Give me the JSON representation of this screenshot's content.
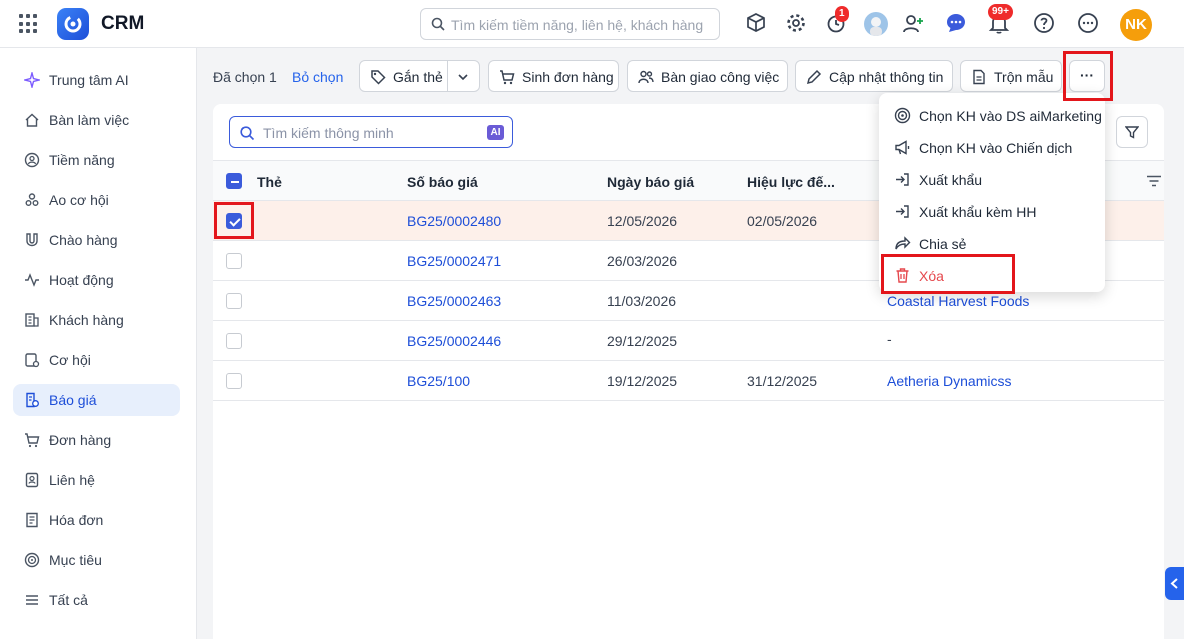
{
  "app": {
    "title": "CRM"
  },
  "topbar": {
    "search_placeholder": "Tìm kiếm tiềm năng, liên hệ, khách hàng",
    "timer_badge": "1",
    "notification_badge": "99+",
    "user_initials": "NK"
  },
  "sidebar": {
    "items": [
      {
        "label": "Trung tâm AI",
        "icon": "sparkle-icon"
      },
      {
        "label": "Bàn làm việc",
        "icon": "home-icon"
      },
      {
        "label": "Tiềm năng",
        "icon": "target-user-icon"
      },
      {
        "label": "Ao cơ hội",
        "icon": "users-icon"
      },
      {
        "label": "Chào hàng",
        "icon": "magnet-icon"
      },
      {
        "label": "Hoạt động",
        "icon": "activity-icon"
      },
      {
        "label": "Khách hàng",
        "icon": "building-icon"
      },
      {
        "label": "Cơ hội",
        "icon": "opportunity-icon"
      },
      {
        "label": "Báo giá",
        "icon": "quote-icon",
        "active": true
      },
      {
        "label": "Đơn hàng",
        "icon": "cart-icon"
      },
      {
        "label": "Liên hệ",
        "icon": "contact-icon"
      },
      {
        "label": "Hóa đơn",
        "icon": "invoice-icon"
      },
      {
        "label": "Mục tiêu",
        "icon": "goal-icon"
      },
      {
        "label": "Tất cả",
        "icon": "menu-icon"
      }
    ]
  },
  "toolbar": {
    "selected_text": "Đã chọn 1",
    "deselect": "Bỏ chọn",
    "tag": "Gắn thẻ",
    "create_order": "Sinh đơn hàng",
    "assign": "Bàn giao công việc",
    "update_info": "Cập nhật thông tin",
    "merge": "Trộn mẫu",
    "more": "···"
  },
  "search": {
    "placeholder": "Tìm kiếm thông minh",
    "ai_badge": "AI"
  },
  "table": {
    "columns": [
      "Thẻ",
      "Số báo giá",
      "Ngày báo giá",
      "Hiệu lực đế..."
    ],
    "rows": [
      {
        "checked": true,
        "number": "BG25/0002480",
        "date": "12/05/2026",
        "valid_until": "02/05/2026",
        "customer": ""
      },
      {
        "checked": false,
        "number": "BG25/0002471",
        "date": "26/03/2026",
        "valid_until": "",
        "customer": ""
      },
      {
        "checked": false,
        "number": "BG25/0002463",
        "date": "11/03/2026",
        "valid_until": "",
        "customer": "Coastal Harvest Foods"
      },
      {
        "checked": false,
        "number": "BG25/0002446",
        "date": "29/12/2025",
        "valid_until": "",
        "customer": "-"
      },
      {
        "checked": false,
        "number": "BG25/100",
        "date": "19/12/2025",
        "valid_until": "31/12/2025",
        "customer": "Aetheria Dynamicss"
      }
    ]
  },
  "menu": {
    "items": [
      {
        "label": "Chọn KH vào DS aiMarketing",
        "icon": "target-icon"
      },
      {
        "label": "Chọn KH vào Chiến dịch",
        "icon": "megaphone-icon"
      },
      {
        "label": "Xuất khẩu",
        "icon": "export-icon"
      },
      {
        "label": "Xuất khẩu kèm HH",
        "icon": "export-items-icon"
      },
      {
        "label": "Chia sẻ",
        "icon": "share-icon"
      },
      {
        "label": "Xóa",
        "icon": "trash-icon",
        "danger": true
      }
    ]
  },
  "colors": {
    "accent": "#2563eb",
    "danger": "#e5484d",
    "highlight": "#e3161b",
    "selected_row": "#fdf0ea"
  }
}
